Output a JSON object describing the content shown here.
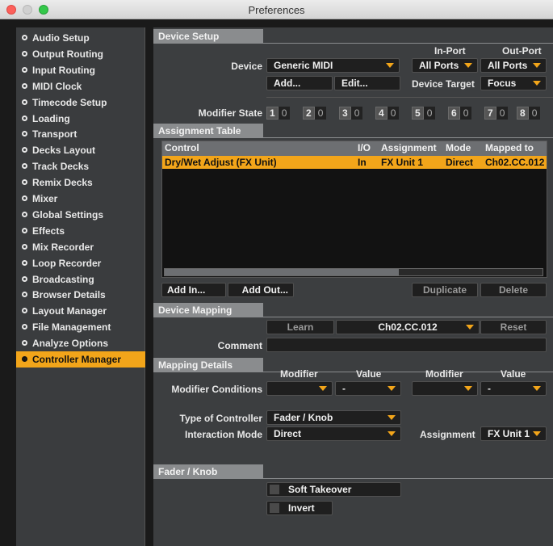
{
  "window": {
    "title": "Preferences"
  },
  "sidebar": {
    "items": [
      {
        "label": "Audio Setup"
      },
      {
        "label": "Output Routing"
      },
      {
        "label": "Input Routing"
      },
      {
        "label": "MIDI Clock"
      },
      {
        "label": "Timecode Setup"
      },
      {
        "label": "Loading"
      },
      {
        "label": "Transport"
      },
      {
        "label": "Decks Layout"
      },
      {
        "label": "Track Decks"
      },
      {
        "label": "Remix Decks"
      },
      {
        "label": "Mixer"
      },
      {
        "label": "Global Settings"
      },
      {
        "label": "Effects"
      },
      {
        "label": "Mix Recorder"
      },
      {
        "label": "Loop Recorder"
      },
      {
        "label": "Broadcasting"
      },
      {
        "label": "Browser Details"
      },
      {
        "label": "Layout Manager"
      },
      {
        "label": "File Management"
      },
      {
        "label": "Analyze Options"
      },
      {
        "label": "Controller Manager"
      }
    ],
    "active_index": 20
  },
  "device_setup": {
    "header": "Device Setup",
    "in_port_label": "In-Port",
    "out_port_label": "Out-Port",
    "device_label": "Device",
    "device_value": "Generic MIDI",
    "in_port_value": "All Ports",
    "out_port_value": "All Ports",
    "add_button": "Add...",
    "edit_button": "Edit...",
    "device_target_label": "Device Target",
    "device_target_value": "Focus",
    "modifier_state_label": "Modifier State",
    "modifiers": [
      {
        "n": "1",
        "v": "0"
      },
      {
        "n": "2",
        "v": "0"
      },
      {
        "n": "3",
        "v": "0"
      },
      {
        "n": "4",
        "v": "0"
      },
      {
        "n": "5",
        "v": "0"
      },
      {
        "n": "6",
        "v": "0"
      },
      {
        "n": "7",
        "v": "0"
      },
      {
        "n": "8",
        "v": "0"
      }
    ]
  },
  "assignment_table": {
    "header": "Assignment Table",
    "columns": [
      "Control",
      "I/O",
      "Assignment",
      "Mode",
      "Mapped to"
    ],
    "rows": [
      {
        "control": "Dry/Wet Adjust (FX Unit)",
        "io": "In",
        "assignment": "FX Unit 1",
        "mode": "Direct",
        "mapped_to": "Ch02.CC.012"
      }
    ],
    "add_in_button": "Add In...",
    "add_out_button": "Add Out...",
    "duplicate_button": "Duplicate",
    "delete_button": "Delete"
  },
  "device_mapping": {
    "header": "Device Mapping",
    "learn_button": "Learn",
    "mapping_value": "Ch02.CC.012",
    "reset_button": "Reset",
    "comment_label": "Comment",
    "comment_value": ""
  },
  "mapping_details": {
    "header": "Mapping Details",
    "modifier_col_1": "Modifier",
    "value_col_1": "Value",
    "modifier_col_2": "Modifier",
    "value_col_2": "Value",
    "modifier_conditions_label": "Modifier Conditions",
    "cond_value_1": "-",
    "cond_value_2": "-",
    "type_label": "Type of Controller",
    "type_value": "Fader / Knob",
    "interaction_label": "Interaction Mode",
    "interaction_value": "Direct",
    "assignment_label": "Assignment",
    "assignment_value": "FX Unit 1"
  },
  "fader_knob": {
    "header": "Fader / Knob",
    "soft_takeover": "Soft Takeover",
    "invert": "Invert"
  },
  "colors": {
    "accent": "#f2a51a",
    "panel": "#3c3e40",
    "section_header": "#8a8c8e"
  }
}
